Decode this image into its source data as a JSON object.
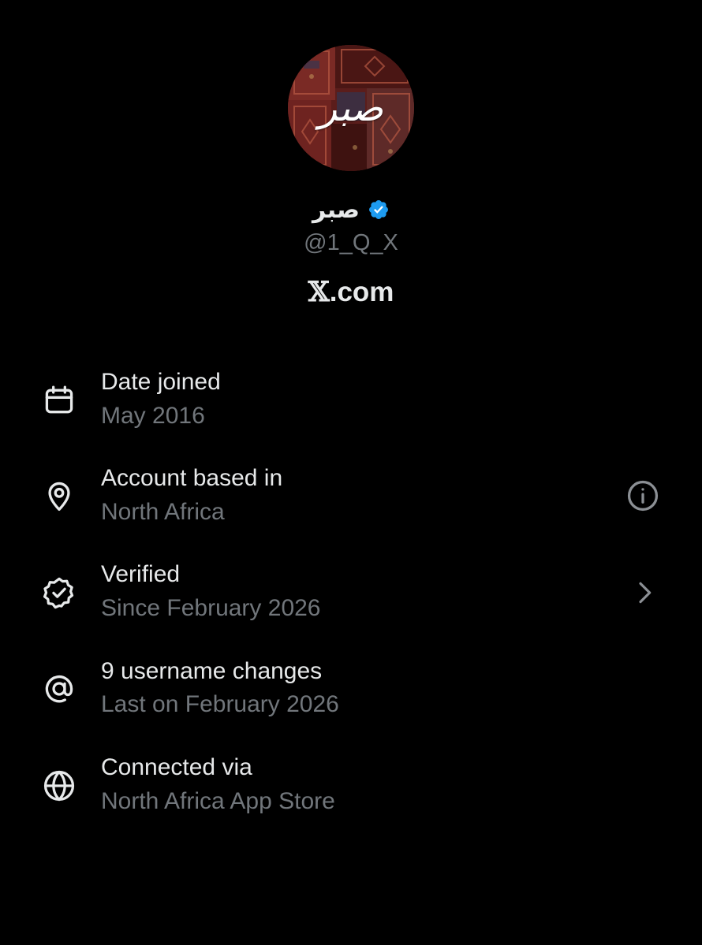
{
  "profile": {
    "avatar_text": "صبر",
    "display_name": "صبر",
    "handle": "@1_Q_X",
    "site_logo": "𝕏",
    "site_suffix": ".com"
  },
  "details": [
    {
      "icon": "calendar-icon",
      "title": "Date joined",
      "value": "May 2016"
    },
    {
      "icon": "location-pin-icon",
      "title": "Account based in",
      "value": "North Africa",
      "trailing": "info-icon"
    },
    {
      "icon": "verified-check-icon",
      "title": "Verified",
      "value": "Since February 2026",
      "trailing": "chevron-right-icon"
    },
    {
      "icon": "at-sign-icon",
      "title": "9 username changes",
      "value": "Last on February 2026"
    },
    {
      "icon": "globe-icon",
      "title": "Connected via",
      "value": "North Africa App Store"
    }
  ],
  "colors": {
    "background": "#000000",
    "primary_text": "#e7e9ea",
    "secondary_text": "#71767b",
    "verified_blue": "#1d9bf0"
  }
}
